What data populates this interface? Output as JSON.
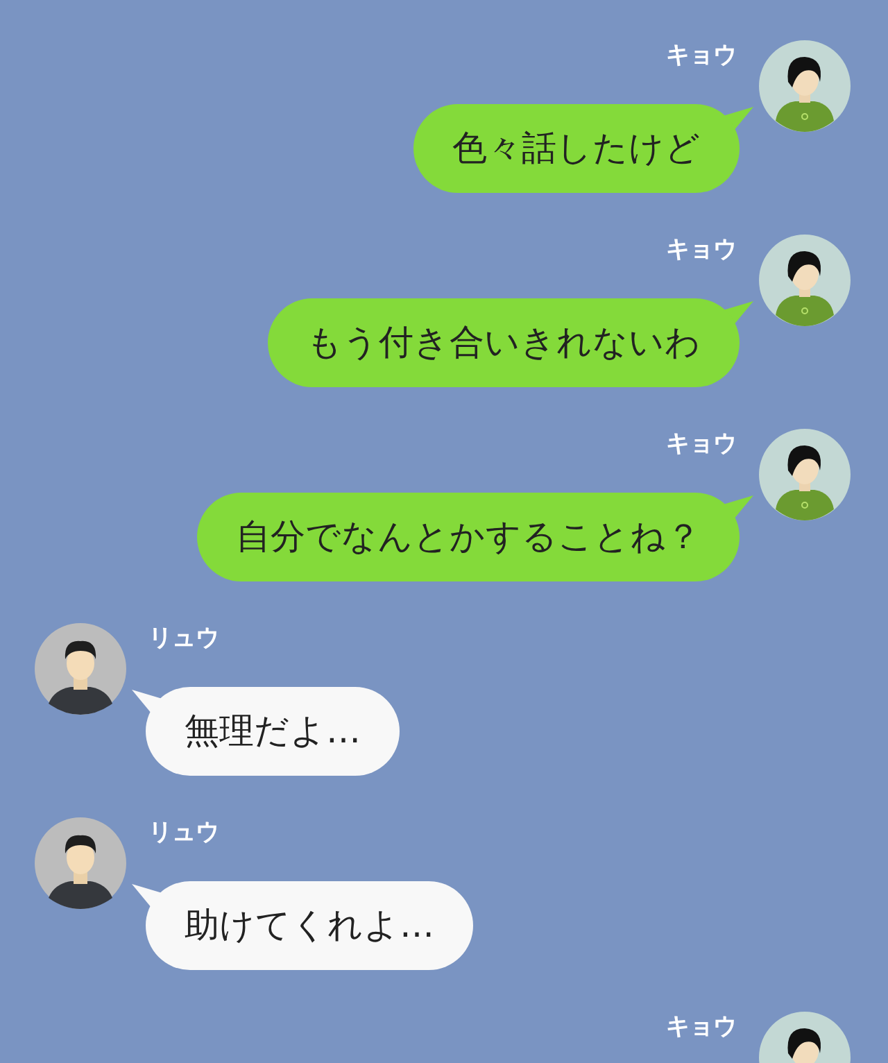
{
  "messages": [
    {
      "kind": "sent",
      "sender": "キョウ",
      "text": "色々話したけど"
    },
    {
      "kind": "sent",
      "sender": "キョウ",
      "text": "もう付き合いきれないわ"
    },
    {
      "kind": "sent",
      "sender": "キョウ",
      "text": "自分でなんとかすることね？"
    },
    {
      "kind": "received",
      "sender": "リュウ",
      "text": "無理だよ…"
    },
    {
      "kind": "received",
      "sender": "リュウ",
      "text": "助けてくれよ…"
    },
    {
      "kind": "sent",
      "sender": "キョウ"
    }
  ]
}
